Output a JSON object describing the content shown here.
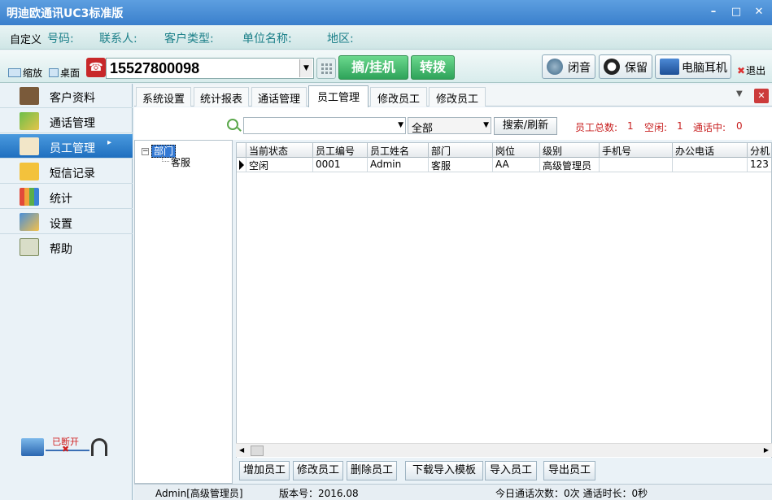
{
  "window": {
    "title": "明迪欧通讯UC3标准版"
  },
  "infobar": {
    "custom": "自定义",
    "number_label": "号码:",
    "contact_label": "联系人:",
    "customer_type_label": "客户类型:",
    "company_label": "单位名称:",
    "region_label": "地区:"
  },
  "toolbar": {
    "shrink": "缩放",
    "desktop": "桌面",
    "phone_number": "15527800098",
    "pickup_hangup": "摘/挂机",
    "transfer": "转拨",
    "mute": "闭音",
    "hold": "保留",
    "pc_headset": "电脑耳机",
    "exit": "退出"
  },
  "sidebar": {
    "items": [
      {
        "label": "客户资料"
      },
      {
        "label": "通话管理"
      },
      {
        "label": "员工管理"
      },
      {
        "label": "短信记录"
      },
      {
        "label": "统计"
      },
      {
        "label": "设置"
      },
      {
        "label": "帮助"
      }
    ],
    "connection_status": "已断开"
  },
  "tabs": [
    {
      "label": "系统设置"
    },
    {
      "label": "统计报表"
    },
    {
      "label": "通话管理"
    },
    {
      "label": "员工管理"
    },
    {
      "label": "修改员工"
    },
    {
      "label": "修改员工"
    }
  ],
  "search": {
    "scope_selected": "全部",
    "button": "搜索/刷新",
    "total_label": "员工总数:",
    "total": "1",
    "idle_label": "空闲:",
    "idle": "1",
    "talking_label": "通话中:",
    "talking": "0"
  },
  "tree": {
    "root": "部门",
    "children": [
      "客服"
    ]
  },
  "table": {
    "columns": [
      "当前状态",
      "员工编号",
      "员工姓名",
      "部门",
      "岗位",
      "级别",
      "手机号",
      "办公电话",
      "分机"
    ],
    "rows": [
      [
        "空闲",
        "0001",
        "Admin",
        "客服",
        "AA",
        "高级管理员",
        "",
        "",
        "123"
      ]
    ]
  },
  "actions": {
    "add": "增加员工",
    "edit": "修改员工",
    "delete": "删除员工",
    "download_template": "下载导入模板",
    "import": "导入员工",
    "export": "导出员工"
  },
  "status": {
    "user": "Admin[高级管理员]",
    "version": "版本号：2016.08",
    "today": "今日通话次数：0次 通话时长：0秒"
  }
}
